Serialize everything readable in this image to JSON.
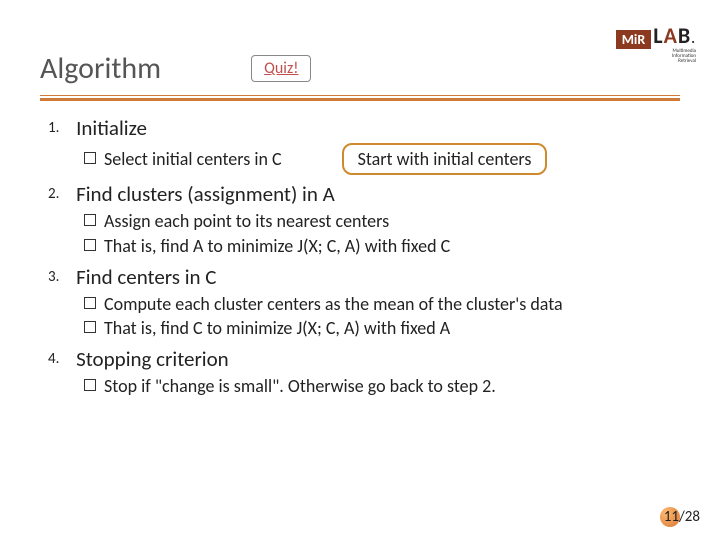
{
  "header": {
    "title": "Algorithm",
    "quiz_label": "Quiz!"
  },
  "logo": {
    "brand_top": "MiR",
    "brand_lab_l": "L",
    "brand_lab_a": "A",
    "brand_lab_b": "B",
    "sub1": "Multimedia",
    "sub2": "Information",
    "sub3": "Retrieval"
  },
  "callout": {
    "text": "Start with initial centers"
  },
  "steps": {
    "s1": {
      "num": "1.",
      "title": "Initialize",
      "bullets": {
        "b1": "Select initial centers in C"
      }
    },
    "s2": {
      "num": "2.",
      "title": "Find clusters (assignment) in A",
      "bullets": {
        "b1": "Assign each point to its nearest centers",
        "b2": "That is, find A to minimize J(X; C, A) with fixed C"
      }
    },
    "s3": {
      "num": "3.",
      "title": "Find centers in C",
      "bullets": {
        "b1": "Compute each cluster centers as the mean of the cluster's data",
        "b2": "That is, find C to minimize J(X; C, A) with fixed A"
      }
    },
    "s4": {
      "num": "4.",
      "title": "Stopping criterion",
      "bullets": {
        "b1": "Stop if \"change is small\". Otherwise go back to step 2."
      }
    }
  },
  "page": {
    "label": "11/28"
  }
}
